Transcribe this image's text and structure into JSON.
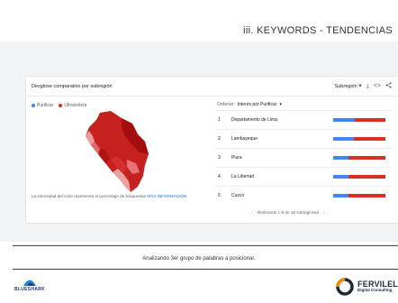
{
  "slide": {
    "title": "iii. KEYWORDS - TENDENCIAS",
    "caption": "Analizando 3er grupo de palabras a posicionar."
  },
  "card": {
    "title": "Desglose comparativo por subregión",
    "region_selector": "Subregión",
    "legend": [
      {
        "label": "Purificar",
        "color": "#4285f4"
      },
      {
        "label": "Ultravioleta",
        "color": "#d93025"
      }
    ],
    "map_note": "La intensidad del color representa el porcentaje de búsquedas",
    "map_link": "MÁS INFORMACIÓN",
    "order_label": "Ordenar:",
    "order_value": "Interés por Purificar",
    "rows": [
      {
        "rank": "1",
        "name": "Departamento de Lima",
        "blue_fraction": 0.42
      },
      {
        "rank": "2",
        "name": "Lambayeque",
        "blue_fraction": 0.4
      },
      {
        "rank": "3",
        "name": "Piura",
        "blue_fraction": 0.3
      },
      {
        "rank": "4",
        "name": "La Libertad",
        "blue_fraction": 0.3
      },
      {
        "rank": "5",
        "name": "Cuzco",
        "blue_fraction": 0.29
      }
    ],
    "pagination": "Mostrando 1-5 de 18 subregiones"
  },
  "logos": {
    "left": "BLUESHARK",
    "right_main": "FERVILEL",
    "right_sub": "Digital Consulting"
  },
  "icons": [
    "chevron-down-icon",
    "download-icon",
    "embed-icon",
    "share-icon",
    "chevron-left-icon",
    "chevron-right-icon"
  ]
}
